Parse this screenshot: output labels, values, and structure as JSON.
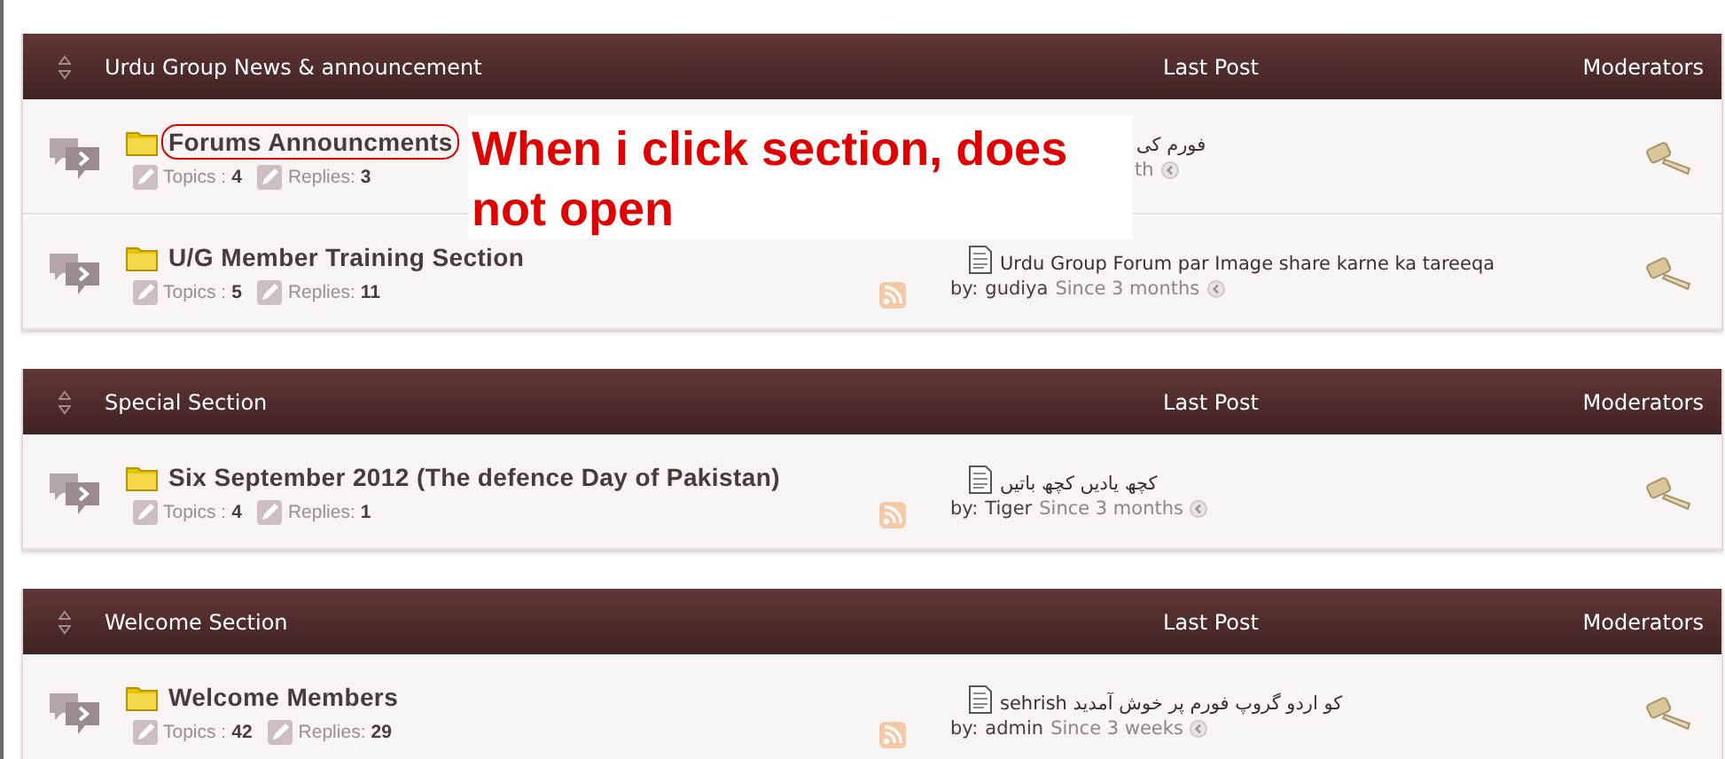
{
  "sections": [
    {
      "title": "Urdu Group News & announcement",
      "last_post_heading": "Last Post",
      "moderators_heading": "Moderators",
      "forums": [
        {
          "name": "Forums Announcments",
          "highlighted": true,
          "topics_label": "Topics :",
          "topics": "4",
          "replies_label": "Replies:",
          "replies": "3",
          "last_post": {
            "kind": "covered",
            "title": "فورم کی",
            "since": "th"
          }
        },
        {
          "name": "U/G Member Training Section",
          "highlighted": false,
          "topics_label": "Topics :",
          "topics": "5",
          "replies_label": "Replies:",
          "replies": "11",
          "last_post": {
            "kind": "full",
            "title": "Urdu Group Forum par Image share karne ka tareeqa",
            "by_label": "by:",
            "author": "gudiya",
            "since": "Since 3 months"
          }
        }
      ]
    },
    {
      "title": "Special Section",
      "last_post_heading": "Last Post",
      "moderators_heading": "Moderators",
      "forums": [
        {
          "name": "Six September 2012 (The defence Day of Pakistan)",
          "highlighted": false,
          "topics_label": "Topics :",
          "topics": "4",
          "replies_label": "Replies:",
          "replies": "1",
          "last_post": {
            "kind": "full",
            "title": "کچھ یادیں کچھ باتیں",
            "by_label": "by:",
            "author": "Tiger",
            "since": "Since 3 months"
          }
        }
      ]
    },
    {
      "title": "Welcome Section",
      "last_post_heading": "Last Post",
      "moderators_heading": "Moderators",
      "forums": [
        {
          "name": "Welcome Members",
          "highlighted": false,
          "topics_label": "Topics :",
          "topics": "42",
          "replies_label": "Replies:",
          "replies": "29",
          "last_post": {
            "kind": "full",
            "title": "sehrish کو اردو گروپ فورم پر خوش آمدید",
            "by_label": "by:",
            "author": "admin",
            "since": "Since 3 weeks"
          }
        }
      ]
    }
  ],
  "annotation": {
    "text": "When i click section, does not open"
  }
}
